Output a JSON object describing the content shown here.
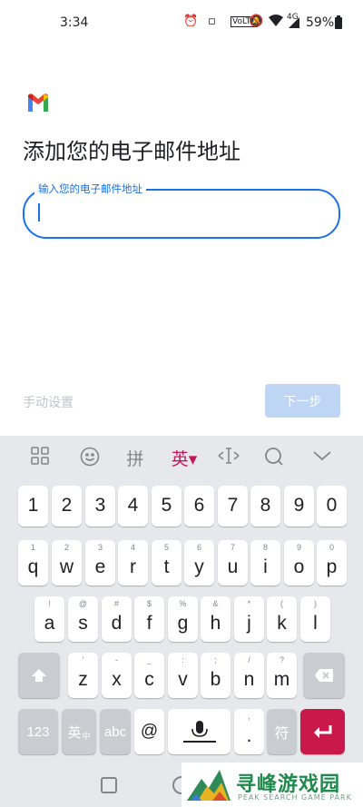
{
  "status_bar": {
    "time": "3:34",
    "network": "4G",
    "battery": "59%"
  },
  "page": {
    "title": "添加您的电子邮件地址",
    "field_label": "输入您的电子邮件地址",
    "field_value": "",
    "manual_setup": "手动设置",
    "next_button": "下一步"
  },
  "keyboard": {
    "toolbar": {
      "pinyin": "拼",
      "english": "英▾"
    },
    "number_row": [
      "1",
      "2",
      "3",
      "4",
      "5",
      "6",
      "7",
      "8",
      "9",
      "0"
    ],
    "row1": [
      {
        "main": "q",
        "sub": "1"
      },
      {
        "main": "w",
        "sub": "2"
      },
      {
        "main": "e",
        "sub": "3"
      },
      {
        "main": "r",
        "sub": "4"
      },
      {
        "main": "t",
        "sub": "5"
      },
      {
        "main": "y",
        "sub": "6"
      },
      {
        "main": "u",
        "sub": "7"
      },
      {
        "main": "i",
        "sub": "8"
      },
      {
        "main": "o",
        "sub": "9"
      },
      {
        "main": "p",
        "sub": "0"
      }
    ],
    "row2": [
      {
        "main": "a",
        "sub": "!"
      },
      {
        "main": "s",
        "sub": "@"
      },
      {
        "main": "d",
        "sub": "#"
      },
      {
        "main": "f",
        "sub": "$"
      },
      {
        "main": "g",
        "sub": "%"
      },
      {
        "main": "h",
        "sub": "&"
      },
      {
        "main": "j",
        "sub": "*"
      },
      {
        "main": "k",
        "sub": "("
      },
      {
        "main": "l",
        "sub": ")"
      }
    ],
    "row3": [
      {
        "main": "z",
        "sub": "'"
      },
      {
        "main": "x",
        "sub": "-"
      },
      {
        "main": "c",
        "sub": "_"
      },
      {
        "main": "v",
        "sub": ":"
      },
      {
        "main": "b",
        "sub": ";"
      },
      {
        "main": "n",
        "sub": "/"
      },
      {
        "main": "m",
        "sub": "?"
      }
    ],
    "bottom": {
      "num_switch": "123",
      "lang_switch": "英",
      "lang_sub": "中",
      "abc": "abc",
      "at": "@",
      "period": ".",
      "period_sub": ",",
      "symbol": "符"
    }
  },
  "watermark": {
    "title": "寻峰游戏园",
    "subtitle": "PEAK SEARCH GAME PARK"
  }
}
